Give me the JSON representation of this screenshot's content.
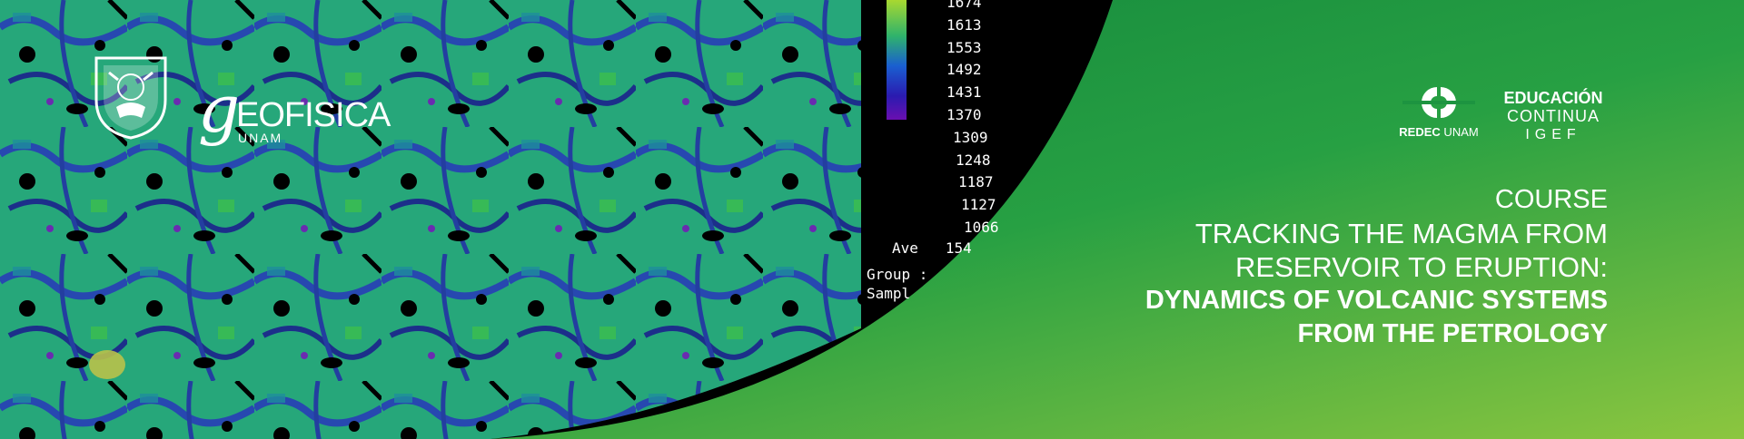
{
  "logos": {
    "unam_icon": "unam-crest-icon",
    "geofisica": {
      "initial": "g",
      "word": "eofisica",
      "sub": "UNAM"
    },
    "redec": {
      "icon": "redec-mark-icon",
      "label_bold": "REDEC",
      "label_rest": " UNAM"
    },
    "educacion": {
      "line1": "EDUCACIÓN",
      "line2": "CONTINUA",
      "line3": "IGEF"
    }
  },
  "course": {
    "kicker": "COURSE",
    "title_light": [
      "TRACKING THE MAGMA FROM",
      "RESERVOIR TO ERUPTION:"
    ],
    "title_bold": [
      "DYNAMICS OF VOLCANIC SYSTEMS",
      "FROM THE PETROLOGY"
    ]
  },
  "scale": {
    "ticks": [
      "1674",
      "1613",
      "1553",
      "1492",
      "1431",
      "1370",
      "1309",
      "1248",
      "1187",
      "1127",
      "1066"
    ],
    "ave_label": "Ave",
    "ave_value": "154",
    "group_label": "Group :",
    "sample_label": "Sampl"
  },
  "colors": {
    "green_dark": "#128a3c",
    "green_light": "#8cc63f",
    "mineral_green": "#2fb36b",
    "mineral_teal": "#1a9c8c",
    "mineral_blue": "#2d4fb8"
  }
}
